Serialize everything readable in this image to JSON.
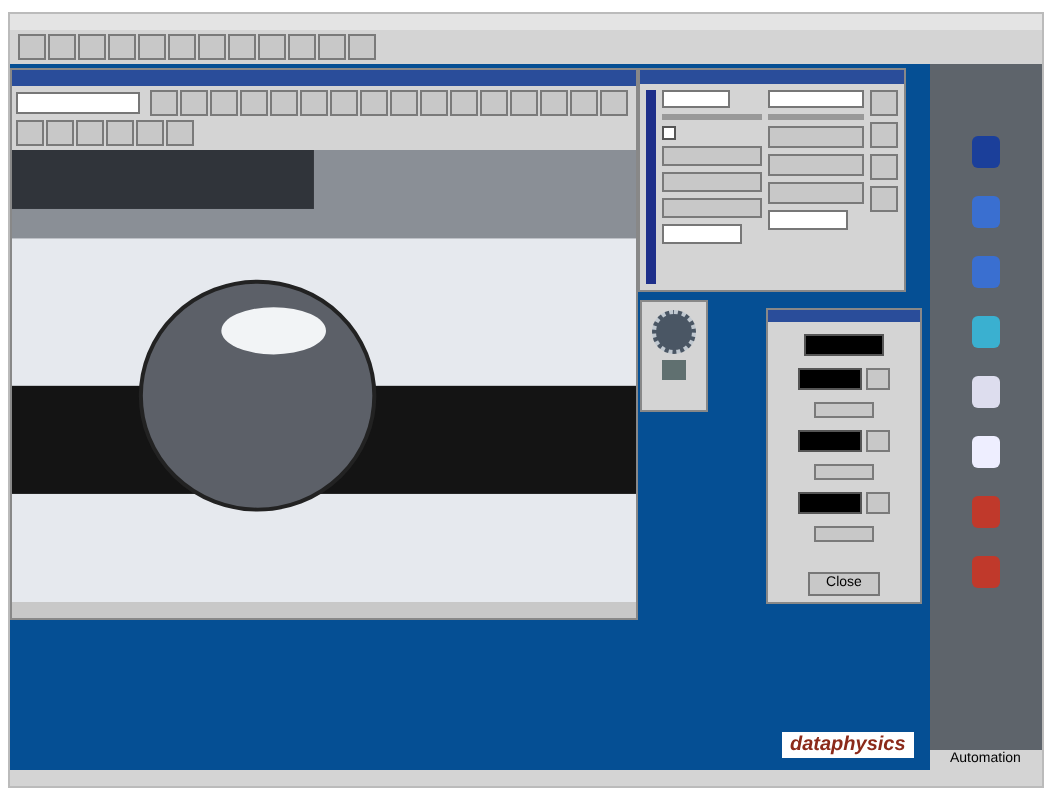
{
  "video_dialog": {
    "close_button": "Close"
  },
  "control_dialog": {
    "checkbox": {
      "checked": false
    }
  },
  "side_panel": {
    "footer": "Automation"
  },
  "logo": {
    "text": "dataphysics"
  }
}
